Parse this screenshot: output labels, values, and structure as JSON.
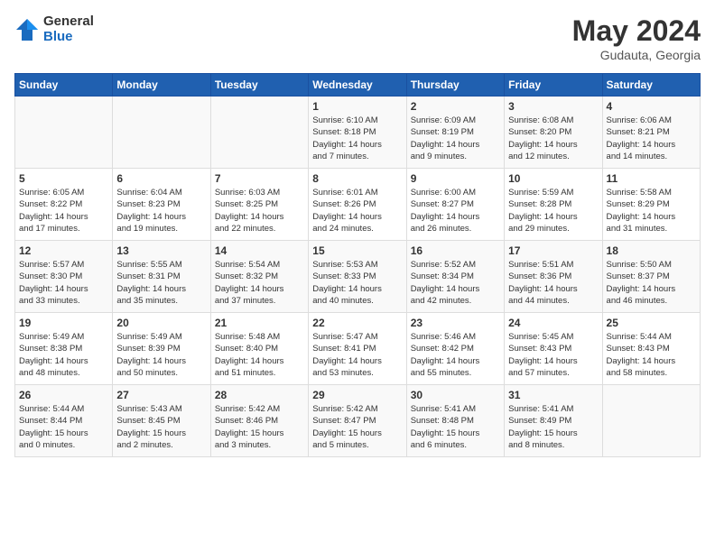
{
  "header": {
    "logo_general": "General",
    "logo_blue": "Blue",
    "title": "May 2024",
    "location": "Gudauta, Georgia"
  },
  "days_of_week": [
    "Sunday",
    "Monday",
    "Tuesday",
    "Wednesday",
    "Thursday",
    "Friday",
    "Saturday"
  ],
  "weeks": [
    [
      {
        "day": "",
        "info": ""
      },
      {
        "day": "",
        "info": ""
      },
      {
        "day": "",
        "info": ""
      },
      {
        "day": "1",
        "info": "Sunrise: 6:10 AM\nSunset: 8:18 PM\nDaylight: 14 hours\nand 7 minutes."
      },
      {
        "day": "2",
        "info": "Sunrise: 6:09 AM\nSunset: 8:19 PM\nDaylight: 14 hours\nand 9 minutes."
      },
      {
        "day": "3",
        "info": "Sunrise: 6:08 AM\nSunset: 8:20 PM\nDaylight: 14 hours\nand 12 minutes."
      },
      {
        "day": "4",
        "info": "Sunrise: 6:06 AM\nSunset: 8:21 PM\nDaylight: 14 hours\nand 14 minutes."
      }
    ],
    [
      {
        "day": "5",
        "info": "Sunrise: 6:05 AM\nSunset: 8:22 PM\nDaylight: 14 hours\nand 17 minutes."
      },
      {
        "day": "6",
        "info": "Sunrise: 6:04 AM\nSunset: 8:23 PM\nDaylight: 14 hours\nand 19 minutes."
      },
      {
        "day": "7",
        "info": "Sunrise: 6:03 AM\nSunset: 8:25 PM\nDaylight: 14 hours\nand 22 minutes."
      },
      {
        "day": "8",
        "info": "Sunrise: 6:01 AM\nSunset: 8:26 PM\nDaylight: 14 hours\nand 24 minutes."
      },
      {
        "day": "9",
        "info": "Sunrise: 6:00 AM\nSunset: 8:27 PM\nDaylight: 14 hours\nand 26 minutes."
      },
      {
        "day": "10",
        "info": "Sunrise: 5:59 AM\nSunset: 8:28 PM\nDaylight: 14 hours\nand 29 minutes."
      },
      {
        "day": "11",
        "info": "Sunrise: 5:58 AM\nSunset: 8:29 PM\nDaylight: 14 hours\nand 31 minutes."
      }
    ],
    [
      {
        "day": "12",
        "info": "Sunrise: 5:57 AM\nSunset: 8:30 PM\nDaylight: 14 hours\nand 33 minutes."
      },
      {
        "day": "13",
        "info": "Sunrise: 5:55 AM\nSunset: 8:31 PM\nDaylight: 14 hours\nand 35 minutes."
      },
      {
        "day": "14",
        "info": "Sunrise: 5:54 AM\nSunset: 8:32 PM\nDaylight: 14 hours\nand 37 minutes."
      },
      {
        "day": "15",
        "info": "Sunrise: 5:53 AM\nSunset: 8:33 PM\nDaylight: 14 hours\nand 40 minutes."
      },
      {
        "day": "16",
        "info": "Sunrise: 5:52 AM\nSunset: 8:34 PM\nDaylight: 14 hours\nand 42 minutes."
      },
      {
        "day": "17",
        "info": "Sunrise: 5:51 AM\nSunset: 8:36 PM\nDaylight: 14 hours\nand 44 minutes."
      },
      {
        "day": "18",
        "info": "Sunrise: 5:50 AM\nSunset: 8:37 PM\nDaylight: 14 hours\nand 46 minutes."
      }
    ],
    [
      {
        "day": "19",
        "info": "Sunrise: 5:49 AM\nSunset: 8:38 PM\nDaylight: 14 hours\nand 48 minutes."
      },
      {
        "day": "20",
        "info": "Sunrise: 5:49 AM\nSunset: 8:39 PM\nDaylight: 14 hours\nand 50 minutes."
      },
      {
        "day": "21",
        "info": "Sunrise: 5:48 AM\nSunset: 8:40 PM\nDaylight: 14 hours\nand 51 minutes."
      },
      {
        "day": "22",
        "info": "Sunrise: 5:47 AM\nSunset: 8:41 PM\nDaylight: 14 hours\nand 53 minutes."
      },
      {
        "day": "23",
        "info": "Sunrise: 5:46 AM\nSunset: 8:42 PM\nDaylight: 14 hours\nand 55 minutes."
      },
      {
        "day": "24",
        "info": "Sunrise: 5:45 AM\nSunset: 8:43 PM\nDaylight: 14 hours\nand 57 minutes."
      },
      {
        "day": "25",
        "info": "Sunrise: 5:44 AM\nSunset: 8:43 PM\nDaylight: 14 hours\nand 58 minutes."
      }
    ],
    [
      {
        "day": "26",
        "info": "Sunrise: 5:44 AM\nSunset: 8:44 PM\nDaylight: 15 hours\nand 0 minutes."
      },
      {
        "day": "27",
        "info": "Sunrise: 5:43 AM\nSunset: 8:45 PM\nDaylight: 15 hours\nand 2 minutes."
      },
      {
        "day": "28",
        "info": "Sunrise: 5:42 AM\nSunset: 8:46 PM\nDaylight: 15 hours\nand 3 minutes."
      },
      {
        "day": "29",
        "info": "Sunrise: 5:42 AM\nSunset: 8:47 PM\nDaylight: 15 hours\nand 5 minutes."
      },
      {
        "day": "30",
        "info": "Sunrise: 5:41 AM\nSunset: 8:48 PM\nDaylight: 15 hours\nand 6 minutes."
      },
      {
        "day": "31",
        "info": "Sunrise: 5:41 AM\nSunset: 8:49 PM\nDaylight: 15 hours\nand 8 minutes."
      },
      {
        "day": "",
        "info": ""
      }
    ]
  ]
}
